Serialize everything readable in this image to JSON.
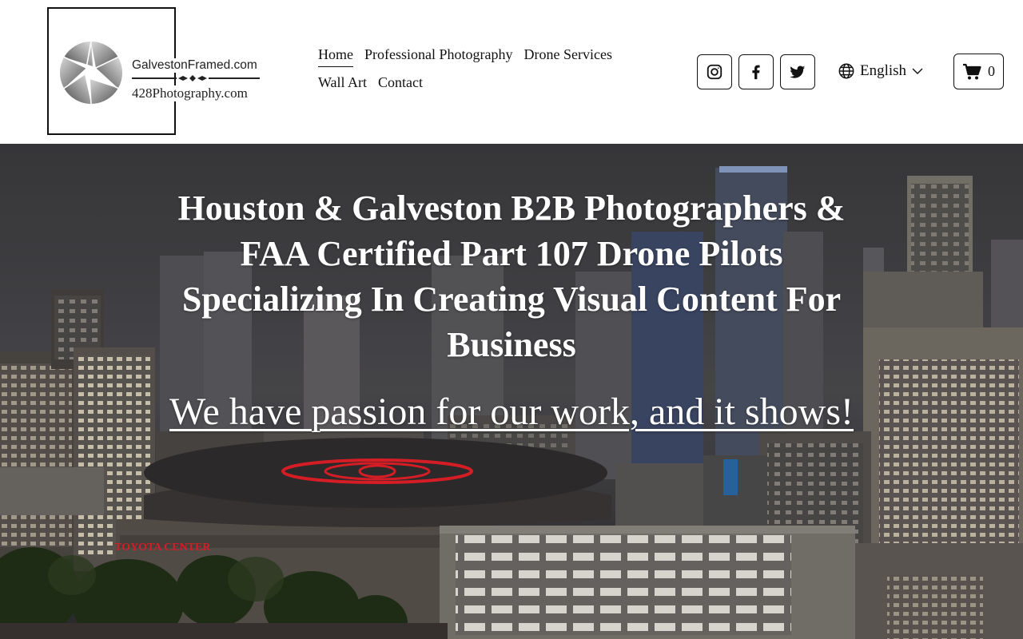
{
  "brand": {
    "line1": "GalvestonFramed.com",
    "line2": "428Photography.com"
  },
  "nav": {
    "items": [
      {
        "label": "Home",
        "active": true
      },
      {
        "label": "Professional Photography",
        "active": false
      },
      {
        "label": "Drone Services",
        "active": false
      },
      {
        "label": "Wall Art",
        "active": false
      },
      {
        "label": "Contact",
        "active": false
      }
    ]
  },
  "social": [
    {
      "icon": "instagram-icon"
    },
    {
      "icon": "facebook-icon"
    },
    {
      "icon": "twitter-icon"
    }
  ],
  "language": {
    "icon": "globe-icon",
    "label": "English"
  },
  "cart": {
    "icon": "cart-icon",
    "count": "0"
  },
  "hero": {
    "title": "Houston & Galveston B2B Photographers & FAA Certified Part 107 Drone Pilots Specializing In Creating Visual Content For Business",
    "tagline": "We have passion for our work, and it shows!",
    "arena_sign": "TOYOTA CENTER"
  },
  "colors": {
    "text": "#111111",
    "hero_text": "#ffffff",
    "arena_red": "#e8202a"
  }
}
